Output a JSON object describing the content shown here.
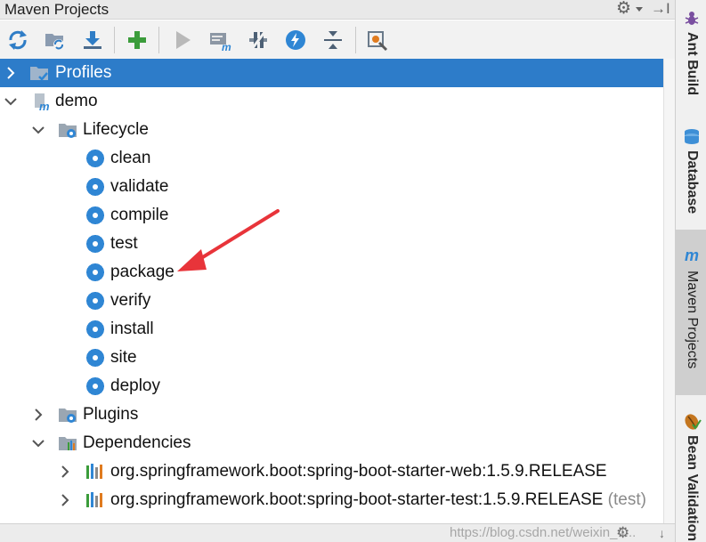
{
  "panel": {
    "title": "Maven Projects",
    "title_icons": [
      "gear-icon",
      "chevron-down-icon",
      "hide-panel-icon"
    ]
  },
  "toolbar": {
    "buttons": [
      {
        "name": "reimport-all-button",
        "icon": "refresh-icon"
      },
      {
        "name": "generate-sources-button",
        "icon": "folder-refresh-icon"
      },
      {
        "name": "download-sources-button",
        "icon": "download-icon"
      },
      {
        "name": "add-maven-project-button",
        "icon": "plus-icon"
      },
      {
        "name": "run-maven-build-button",
        "icon": "play-icon"
      },
      {
        "name": "execute-maven-goal-button",
        "icon": "maven-goal-icon"
      },
      {
        "name": "toggle-offline-mode-button",
        "icon": "offline-icon"
      },
      {
        "name": "skip-tests-button",
        "icon": "lightning-icon"
      },
      {
        "name": "collapse-all-button",
        "icon": "collapse-all-icon"
      },
      {
        "name": "maven-settings-button",
        "icon": "wrench-settings-icon"
      }
    ]
  },
  "tree": {
    "profiles": {
      "label": "Profiles",
      "expanded": false,
      "selected": true
    },
    "project": {
      "label": "demo",
      "expanded": true
    },
    "lifecycle": {
      "label": "Lifecycle",
      "expanded": true,
      "goals": [
        "clean",
        "validate",
        "compile",
        "test",
        "package",
        "verify",
        "install",
        "site",
        "deploy"
      ]
    },
    "plugins": {
      "label": "Plugins",
      "expanded": false
    },
    "dependencies": {
      "label": "Dependencies",
      "expanded": true,
      "items": [
        {
          "label": "org.springframework.boot:spring-boot-starter-web:1.5.9.RELEASE",
          "suffix": ""
        },
        {
          "label": "org.springframework.boot:spring-boot-starter-test:1.5.9.RELEASE",
          "suffix": "(test)"
        }
      ]
    }
  },
  "watermark": "https://blog.csdn.net/weixin_4...",
  "annotation": {
    "type": "arrow",
    "color": "#e8343a",
    "points_to": "package"
  },
  "sidebar": {
    "tabs": [
      {
        "label": "Ant Build",
        "icon": "ant-icon",
        "active": false
      },
      {
        "label": "Database",
        "icon": "database-icon",
        "active": false
      },
      {
        "label": "Maven Projects",
        "icon": "maven-m-icon",
        "active": true
      },
      {
        "label": "Bean Validation",
        "icon": "bean-icon",
        "active": false
      }
    ]
  },
  "colors": {
    "selection": "#2d7cc9",
    "gear_blue": "#2f86d4",
    "plus_green": "#3b9c3b",
    "arrow_red": "#e8343a"
  }
}
